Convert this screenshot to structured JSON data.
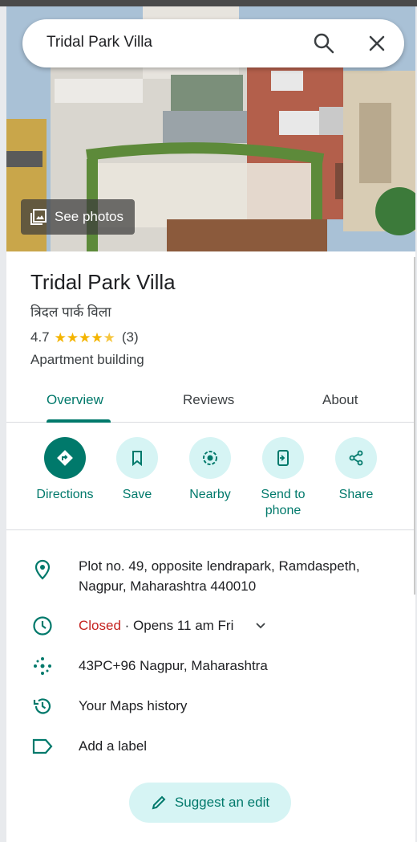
{
  "search": {
    "value": "Tridal Park Villa"
  },
  "hero": {
    "see_photos_label": "See photos"
  },
  "place": {
    "name": "Tridal Park Villa",
    "native_name": "त्रिदल पार्क विला",
    "rating": "4.7",
    "stars": [
      "★",
      "★",
      "★",
      "★",
      "★"
    ],
    "review_count": "(3)",
    "category": "Apartment building"
  },
  "tabs": [
    {
      "label": "Overview",
      "active": true
    },
    {
      "label": "Reviews",
      "active": false
    },
    {
      "label": "About",
      "active": false
    }
  ],
  "actions": [
    {
      "label": "Directions",
      "icon": "directions-icon"
    },
    {
      "label": "Save",
      "icon": "bookmark-icon"
    },
    {
      "label": "Nearby",
      "icon": "nearby-icon"
    },
    {
      "label": "Send to phone",
      "icon": "send-to-phone-icon"
    },
    {
      "label": "Share",
      "icon": "share-icon"
    }
  ],
  "info": {
    "address": "Plot no. 49, opposite lendrapark, Ramdaspeth, Nagpur, Maharashtra 440010",
    "hours_status": "Closed",
    "hours_detail": " · Opens 11 am Fri",
    "plus_code": "43PC+96 Nagpur, Maharashtra",
    "history": "Your Maps history",
    "label": "Add a label"
  },
  "suggest_edit_label": "Suggest an edit",
  "colors": {
    "accent": "#00796b",
    "accent_light": "#d6f4f4",
    "closed": "#c5221f",
    "star": "#f4b400"
  }
}
